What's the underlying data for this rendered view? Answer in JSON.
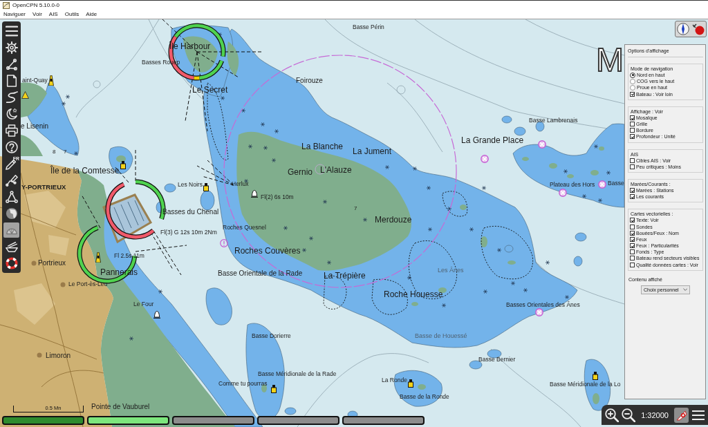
{
  "window": {
    "title": "OpenCPN 5.10.0-0"
  },
  "menu": [
    {
      "label": "Naviguer"
    },
    {
      "label": "Voir"
    },
    {
      "label": "AIS"
    },
    {
      "label": "Outils"
    },
    {
      "label": "Aide"
    }
  ],
  "toolbar": [
    {
      "on": false
    },
    {
      "on": false
    },
    {
      "on": false
    },
    {
      "on": false
    },
    {
      "on": false
    },
    {
      "on": false
    },
    {
      "on": false
    },
    {
      "on": false
    },
    {
      "on": false,
      "badge": "FR"
    },
    {
      "on": false
    },
    {
      "on": false
    },
    {
      "on": false
    },
    {
      "on": true
    },
    {
      "on": false
    },
    {
      "on": false
    }
  ],
  "chart": {
    "labels": [
      {
        "text": "Basse Périn",
        "kind": "small"
      },
      {
        "text": "Île Harbour",
        "kind": "large"
      },
      {
        "text": "Basses Rouep",
        "kind": "small"
      },
      {
        "text": "M",
        "kind": "letter"
      },
      {
        "text": "Le Secret",
        "kind": "large"
      },
      {
        "text": "Foirouze",
        "kind": "medium"
      },
      {
        "text": "aint-Quay",
        "kind": "small"
      },
      {
        "text": "e Lisenin",
        "kind": "medium"
      },
      {
        "text": "8",
        "kind": "sounding"
      },
      {
        "text": "7",
        "kind": "sounding"
      },
      {
        "text": "Île de la Comtesse",
        "kind": "large"
      },
      {
        "text": "Y-PORTRIEUX",
        "kind": "town"
      },
      {
        "text": "Les Noirs",
        "kind": "small"
      },
      {
        "text": "Herlux",
        "kind": "small"
      },
      {
        "text": "Fl(2) 6s 10m",
        "kind": "light"
      },
      {
        "text": "La Blanche",
        "kind": "large"
      },
      {
        "text": "La Jument",
        "kind": "large"
      },
      {
        "text": "Gernio",
        "kind": "large"
      },
      {
        "text": "L'Alauze",
        "kind": "large"
      },
      {
        "text": "La Grande Place",
        "kind": "large"
      },
      {
        "text": "Basse Lambrenais",
        "kind": "small"
      },
      {
        "text": "Plateau des Hors",
        "kind": "small"
      },
      {
        "text": "Basse",
        "kind": "small"
      },
      {
        "text": "Basses du Chenal",
        "kind": "medium"
      },
      {
        "text": "Fl(3) G 12s 10m 2Nm",
        "kind": "light"
      },
      {
        "text": "Roches Quesnel",
        "kind": "small"
      },
      {
        "text": "7",
        "kind": "sounding"
      },
      {
        "text": "Merdouze",
        "kind": "large"
      },
      {
        "text": "Roches Couvères",
        "kind": "large"
      },
      {
        "text": "Fl 2.5s 11m",
        "kind": "light"
      },
      {
        "text": "Portrieux",
        "kind": "medium"
      },
      {
        "text": "Pannerais",
        "kind": "large"
      },
      {
        "text": "Basse Orientale de la Rade",
        "kind": "medium"
      },
      {
        "text": "La Trépière",
        "kind": "large"
      },
      {
        "text": "Les Ânes",
        "kind": "faded"
      },
      {
        "text": "Le Port-ès-Leu",
        "kind": "small"
      },
      {
        "text": "Roche Houesse",
        "kind": "large"
      },
      {
        "text": "Le Four",
        "kind": "small"
      },
      {
        "text": "Basses Orientales des Ânes",
        "kind": "small"
      },
      {
        "text": "Basse Dorierre",
        "kind": "small"
      },
      {
        "text": "Basse de Houessé",
        "kind": "faded"
      },
      {
        "text": "Limoron",
        "kind": "medium"
      },
      {
        "text": "Basse Bernier",
        "kind": "small"
      },
      {
        "text": "Basse Méridionale de la Rade",
        "kind": "small"
      },
      {
        "text": "Comme tu pourras",
        "kind": "small"
      },
      {
        "text": "La Ronde",
        "kind": "small"
      },
      {
        "text": "Basse Méridionale de la Lo",
        "kind": "small"
      },
      {
        "text": "Basse de la Ronde",
        "kind": "small"
      },
      {
        "text": "Pointe de Vauburel",
        "kind": "medium"
      }
    ],
    "scale_bar": "0.5 Mn"
  },
  "display_options": {
    "title": "Options d'affichage",
    "groups": [
      {
        "title": "Mode de navigation",
        "items": [
          {
            "kind": "radio",
            "label": "Nord en haut",
            "checked": true
          },
          {
            "kind": "radio",
            "label": "COG vers le haut",
            "checked": false
          },
          {
            "kind": "radio",
            "label": "Proue en haut",
            "checked": false
          },
          {
            "kind": "checkbox",
            "label": "Bateau : Voir loin",
            "checked": true
          }
        ]
      },
      {
        "title": "Affichage : Voir",
        "items": [
          {
            "kind": "checkbox",
            "label": "Mosaïque",
            "checked": true
          },
          {
            "kind": "checkbox",
            "label": "Grille",
            "checked": false
          },
          {
            "kind": "checkbox",
            "label": "Bordure",
            "checked": false
          },
          {
            "kind": "checkbox",
            "label": "Profondeur : Unité",
            "checked": true
          }
        ]
      },
      {
        "title": "AIS",
        "items": [
          {
            "kind": "checkbox",
            "label": "Cibles AIS : Voir",
            "checked": false
          },
          {
            "kind": "checkbox",
            "label": "Peu critiques : Moins",
            "checked": false
          }
        ]
      },
      {
        "title": "Marées/Courants :",
        "items": [
          {
            "kind": "checkbox",
            "label": "Marées : Stations",
            "checked": true
          },
          {
            "kind": "checkbox",
            "label": "Les courants",
            "checked": true
          }
        ]
      },
      {
        "title": "Cartes vectorielles :",
        "items": [
          {
            "kind": "checkbox",
            "label": "Texte: Voir",
            "checked": true
          },
          {
            "kind": "checkbox",
            "label": "Sondes",
            "checked": false
          },
          {
            "kind": "checkbox",
            "label": "Bouées/Feux : Nom",
            "checked": true
          },
          {
            "kind": "checkbox",
            "label": "Feux",
            "checked": true
          },
          {
            "kind": "checkbox",
            "label": "Feux : Particularités",
            "checked": true
          },
          {
            "kind": "checkbox",
            "label": "Fonds : Type",
            "checked": false
          },
          {
            "kind": "checkbox",
            "label": "Bateau rend secteurs visibles",
            "checked": false
          },
          {
            "kind": "checkbox",
            "label": "Qualité données cartes : Voir",
            "checked": false
          }
        ]
      }
    ],
    "content": {
      "label": "Contenu affiché",
      "value": "Choix personnel"
    }
  },
  "chart_bar": [
    {
      "color": "#2e8b2e"
    },
    {
      "color": "#7de67d"
    },
    {
      "color": "#8c8c8c"
    },
    {
      "color": "#8c8c8c"
    },
    {
      "color": "#8c8c8c"
    }
  ],
  "zoom_bar": {
    "scale": "1:32000"
  }
}
